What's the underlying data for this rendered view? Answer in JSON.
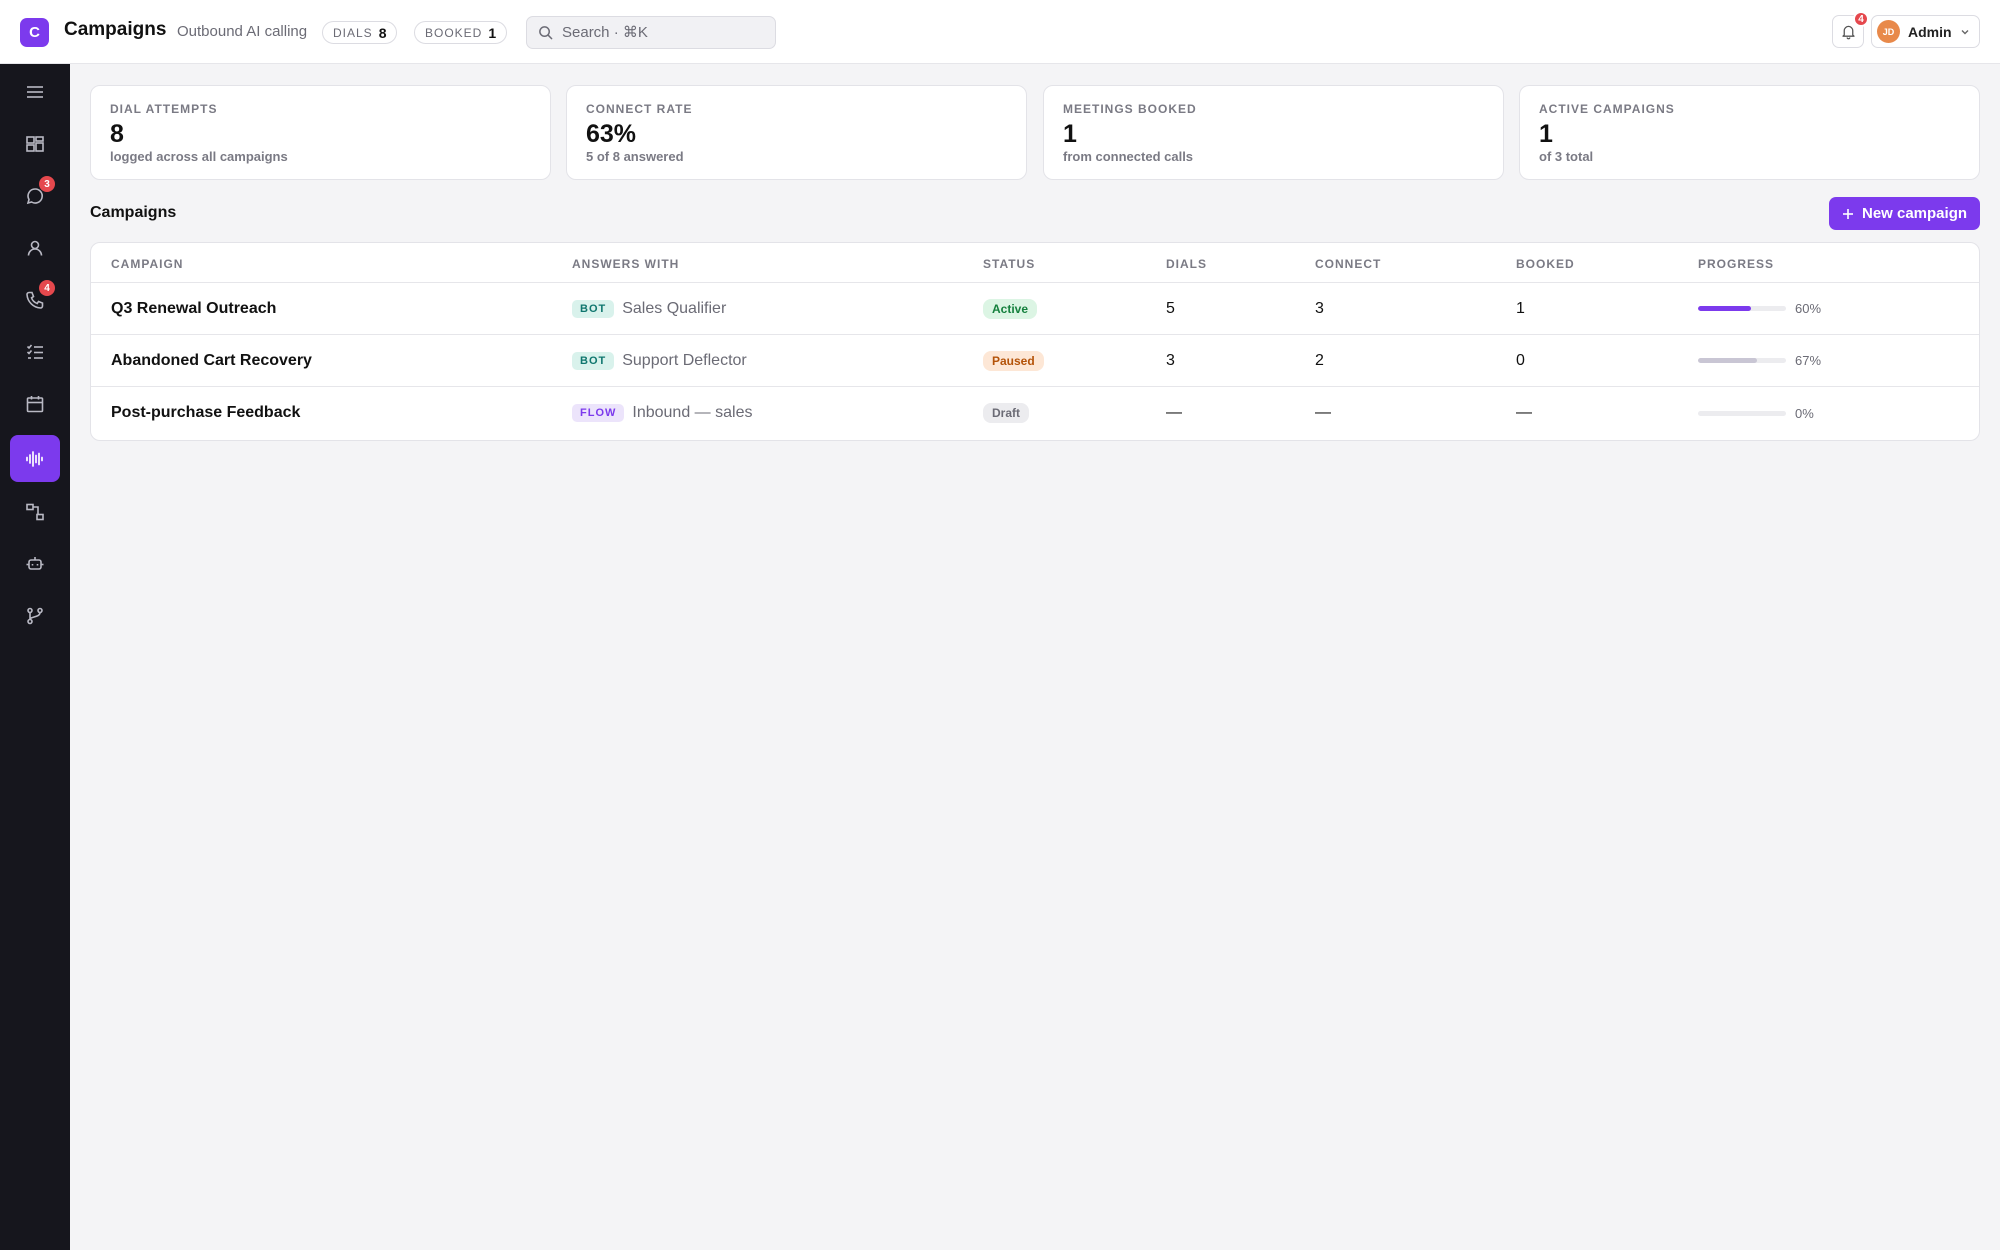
{
  "app": {
    "logo_letter": "C",
    "title": "Campaigns",
    "subtitle": "Outbound AI calling"
  },
  "header_pills": [
    {
      "label": "DIALS",
      "value": "8"
    },
    {
      "label": "BOOKED",
      "value": "1"
    }
  ],
  "search": {
    "placeholder": "Search · ⌘K"
  },
  "notifications": {
    "count": "4"
  },
  "user": {
    "initials": "JD",
    "name": "Admin"
  },
  "sidebar": {
    "items": [
      {
        "name": "menu",
        "icon": "menu-icon"
      },
      {
        "name": "dashboard",
        "icon": "dashboard-icon"
      },
      {
        "name": "messages",
        "icon": "chat-icon",
        "badge": "3"
      },
      {
        "name": "contacts",
        "icon": "person-icon"
      },
      {
        "name": "calls",
        "icon": "phone-icon",
        "badge": "4"
      },
      {
        "name": "tasks",
        "icon": "checklist-icon"
      },
      {
        "name": "calendar",
        "icon": "calendar-icon"
      },
      {
        "name": "campaigns",
        "icon": "waveform-icon",
        "active": true
      },
      {
        "name": "flows",
        "icon": "flow-icon"
      },
      {
        "name": "bots",
        "icon": "robot-icon"
      },
      {
        "name": "integrations",
        "icon": "branch-icon"
      }
    ]
  },
  "stats": [
    {
      "label": "DIAL ATTEMPTS",
      "value": "8",
      "note": "logged across all campaigns"
    },
    {
      "label": "CONNECT RATE",
      "value": "63%",
      "note": "5 of 8 answered"
    },
    {
      "label": "MEETINGS BOOKED",
      "value": "1",
      "note": "from connected calls"
    },
    {
      "label": "ACTIVE CAMPAIGNS",
      "value": "1",
      "note": "of 3 total"
    }
  ],
  "section": {
    "title": "Campaigns",
    "new_button": "New campaign"
  },
  "table": {
    "columns": [
      "CAMPAIGN",
      "ANSWERS WITH",
      "STATUS",
      "DIALS",
      "CONNECT",
      "BOOKED",
      "PROGRESS"
    ],
    "rows": [
      {
        "campaign": "Q3 Renewal Outreach",
        "agent_type": "BOT",
        "agent": "Sales Qualifier",
        "status": "Active",
        "dials": "5",
        "connect": "3",
        "booked": "1",
        "progress_label": "60%",
        "progress": 0.6
      },
      {
        "campaign": "Abandoned Cart Recovery",
        "agent_type": "BOT",
        "agent": "Support Deflector",
        "status": "Paused",
        "dials": "3",
        "connect": "2",
        "booked": "0",
        "progress_label": "67%",
        "progress": 0.67
      },
      {
        "campaign": "Post-purchase Feedback",
        "agent_type": "FLOW",
        "agent": "Inbound — sales",
        "status": "Draft",
        "dials": "—",
        "connect": "—",
        "booked": "—",
        "progress_label": "0%",
        "progress": 0
      }
    ]
  },
  "colors": {
    "accent": "#7c3aed",
    "progress_paused": "#c9c6d4",
    "sidebar_bg": "#16161d"
  }
}
